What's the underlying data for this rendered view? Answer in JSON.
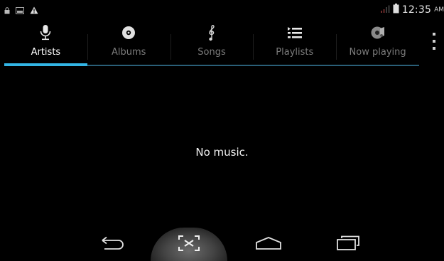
{
  "status_bar": {
    "time": "12:35",
    "ampm": "AM",
    "left_icons": [
      "lock-icon",
      "image-icon",
      "warning-icon"
    ],
    "right_icons": [
      "signal-icon",
      "battery-icon"
    ]
  },
  "tabs": [
    {
      "label": "Artists",
      "icon": "microphone-icon",
      "active": true
    },
    {
      "label": "Albums",
      "icon": "disc-icon",
      "active": false
    },
    {
      "label": "Songs",
      "icon": "music-note-icon",
      "active": false
    },
    {
      "label": "Playlists",
      "icon": "playlist-icon",
      "active": false
    },
    {
      "label": "Now playing",
      "icon": "now-playing-icon",
      "active": false
    }
  ],
  "main": {
    "empty_message": "No music."
  },
  "nav_bar": {
    "buttons": [
      "back-icon",
      "screenshot-icon",
      "home-icon",
      "recent-apps-icon"
    ]
  },
  "colors": {
    "accent": "#33b5e5",
    "background": "#000000",
    "inactive_label": "#7c7c7c"
  }
}
